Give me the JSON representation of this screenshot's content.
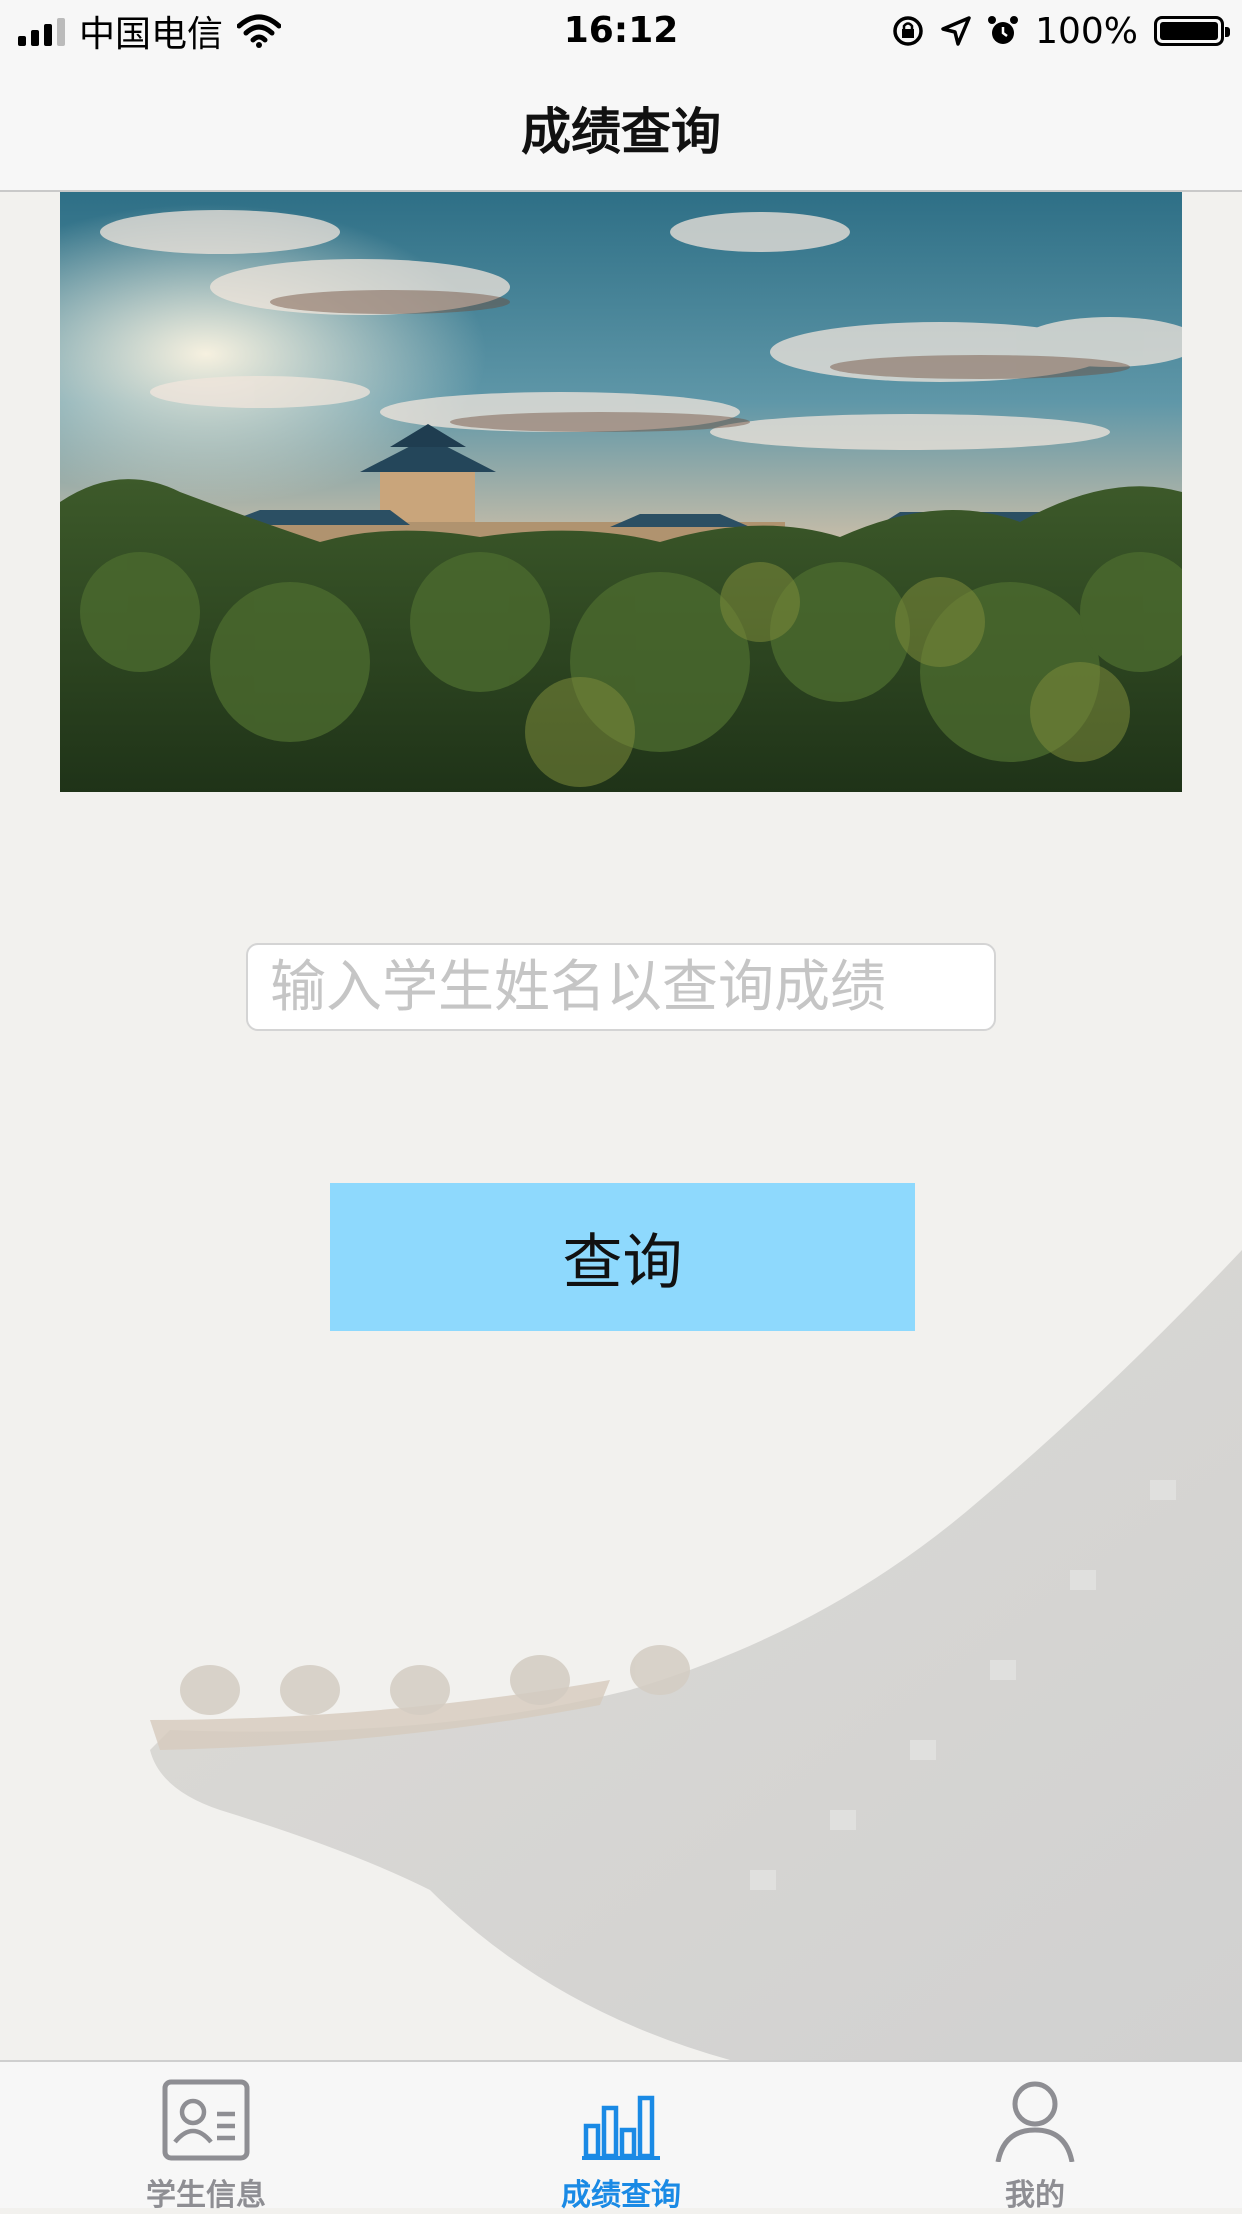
{
  "status_bar": {
    "carrier": "中国电信",
    "time": "16:12",
    "battery": "100%"
  },
  "nav": {
    "title": "成绩查询"
  },
  "search": {
    "placeholder": "输入学生姓名以查询成绩",
    "value": ""
  },
  "query_button": {
    "label": "查询"
  },
  "tabs": [
    {
      "label": "学生信息",
      "icon": "id-card-icon"
    },
    {
      "label": "成绩查询",
      "icon": "bar-chart-icon"
    },
    {
      "label": "我的",
      "icon": "person-icon"
    }
  ],
  "colors": {
    "accent": "#1a8ae5",
    "button": "#8ed9fd",
    "inactive_tab": "#8e8e93"
  }
}
